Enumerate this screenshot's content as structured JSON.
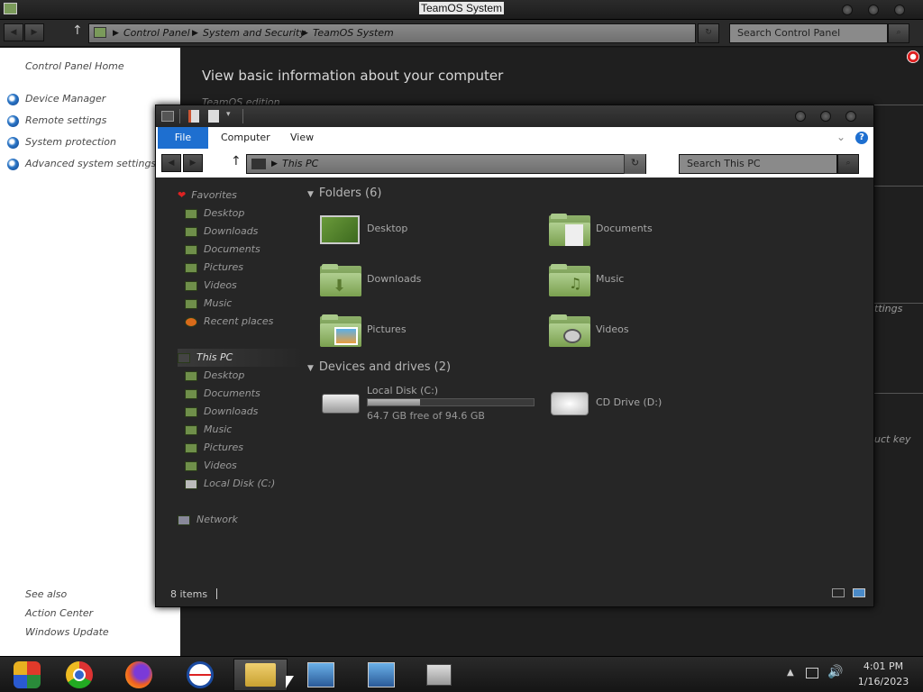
{
  "control_panel": {
    "title": "TeamOS System",
    "breadcrumb": [
      "Control Panel",
      "System and Security",
      "TeamOS System"
    ],
    "search_placeholder": "Search Control Panel",
    "sidebar": {
      "home": "Control Panel Home",
      "items": [
        "Device Manager",
        "Remote settings",
        "System protection",
        "Advanced system settings"
      ],
      "see_also": "See also",
      "see_also_items": [
        "Action Center",
        "Windows Update"
      ]
    },
    "heading": "View basic information about your computer",
    "partial_labels": [
      "TeamOS edition",
      "ttings",
      "uct key"
    ]
  },
  "explorer": {
    "ribbon_tabs": [
      "File",
      "Computer",
      "View"
    ],
    "address": "This PC",
    "search_placeholder": "Search This PC",
    "nav": {
      "favorites_label": "Favorites",
      "favorites": [
        "Desktop",
        "Downloads",
        "Documents",
        "Pictures",
        "Videos",
        "Music",
        "Recent places"
      ],
      "this_pc_label": "This PC",
      "this_pc": [
        "Desktop",
        "Documents",
        "Downloads",
        "Music",
        "Pictures",
        "Videos",
        "Local Disk (C:)"
      ],
      "network_label": "Network"
    },
    "folders_header": "Folders (6)",
    "folders": [
      "Desktop",
      "Documents",
      "Downloads",
      "Music",
      "Pictures",
      "Videos"
    ],
    "drives_header": "Devices and drives (2)",
    "drives": [
      {
        "name": "Local Disk (C:)",
        "free": "64.7 GB free of 94.6 GB",
        "used_fraction": 0.316
      },
      {
        "name": "CD Drive (D:)"
      }
    ],
    "status": "8 items"
  },
  "taskbar": {
    "time": "4:01 PM",
    "date": "1/16/2023"
  },
  "colors": {
    "accent": "#1e6fd0",
    "folder_green": "#7aa04f"
  }
}
